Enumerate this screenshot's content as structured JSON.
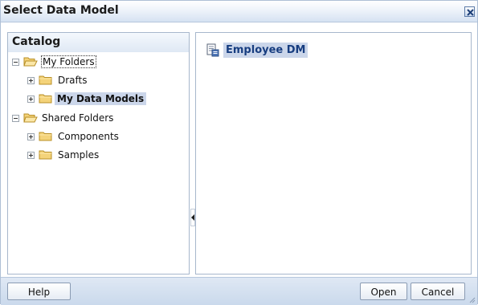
{
  "dialog": {
    "title": "Select Data Model"
  },
  "catalog": {
    "title": "Catalog",
    "tree": [
      {
        "label": "My Folders",
        "expander": "minus",
        "folder": "open",
        "state": "focused"
      },
      {
        "label": "Drafts",
        "expander": "plus",
        "folder": "closed",
        "state": "normal"
      },
      {
        "label": "My Data Models",
        "expander": "plus",
        "folder": "closed",
        "state": "selected"
      },
      {
        "label": "Shared Folders",
        "expander": "minus",
        "folder": "open",
        "state": "normal"
      },
      {
        "label": "Components",
        "expander": "plus",
        "folder": "closed",
        "state": "normal"
      },
      {
        "label": "Samples",
        "expander": "plus",
        "folder": "closed",
        "state": "normal"
      }
    ]
  },
  "content": {
    "items": [
      {
        "label": "Employee DM",
        "icon": "data-model-icon",
        "selected": true
      }
    ]
  },
  "footer": {
    "help_label": "Help",
    "open_label": "Open",
    "cancel_label": "Cancel"
  },
  "colors": {
    "selection": "#cbd6ea",
    "title_gradient_end": "#d6e2f2",
    "footer": "#d2dfef"
  }
}
